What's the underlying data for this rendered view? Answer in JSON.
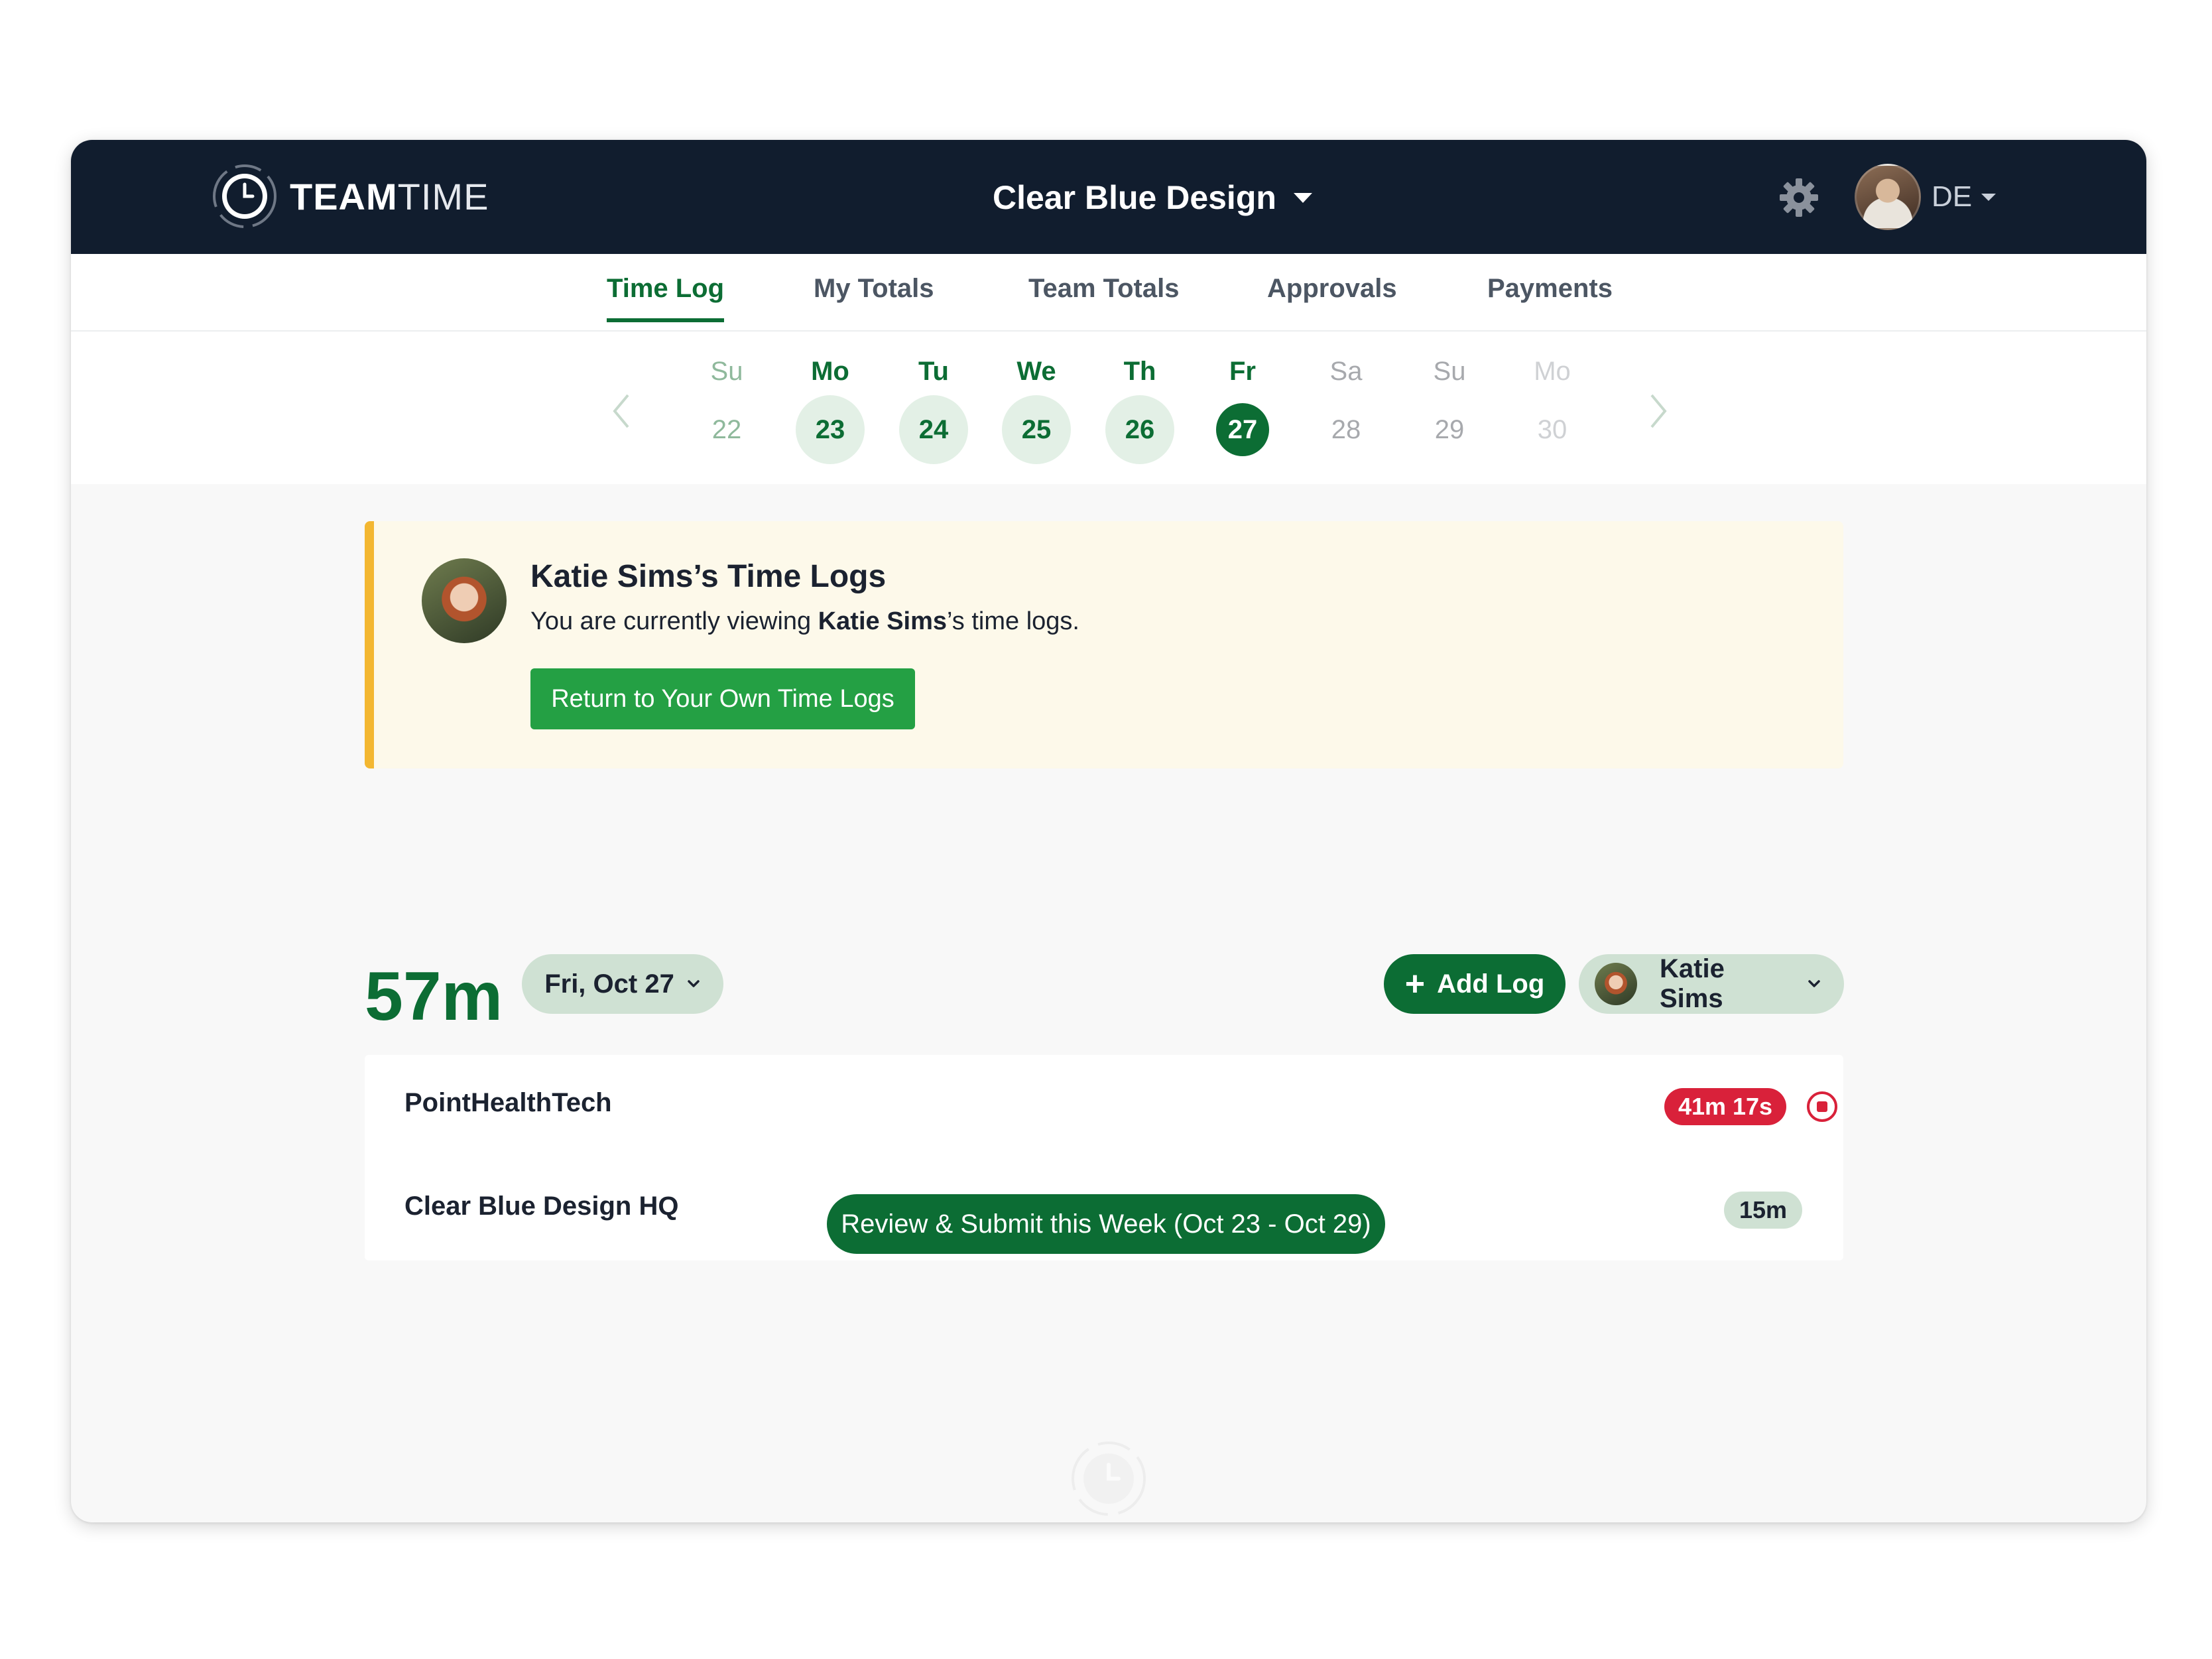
{
  "app": {
    "logo_bold": "TEAM",
    "logo_light": "TIME",
    "organization": "Clear Blue Design",
    "user_initials": "DE"
  },
  "tabs": [
    {
      "label": "Time Log",
      "active": true
    },
    {
      "label": "My Totals"
    },
    {
      "label": "Team Totals"
    },
    {
      "label": "Approvals"
    },
    {
      "label": "Payments"
    }
  ],
  "week": {
    "days": [
      {
        "name": "Su",
        "num": "22"
      },
      {
        "name": "Mo",
        "num": "23"
      },
      {
        "name": "Tu",
        "num": "24"
      },
      {
        "name": "We",
        "num": "25"
      },
      {
        "name": "Th",
        "num": "26"
      },
      {
        "name": "Fr",
        "num": "27"
      },
      {
        "name": "Sa",
        "num": "28"
      },
      {
        "name": "Su",
        "num": "29"
      },
      {
        "name": "Mo",
        "num": "30"
      }
    ],
    "selected": "27"
  },
  "banner": {
    "title": "Katie Sims’s Time Logs",
    "text_prefix": "You are currently viewing ",
    "text_name": "Katie Sims",
    "text_suffix": "’s time logs.",
    "button_label": "Return to Your Own Time Logs"
  },
  "summary": {
    "total": "57m",
    "date": "Fri, Oct 27",
    "add_log_label": "Add Log",
    "user_name": "Katie Sims"
  },
  "logs": [
    {
      "project": "PointHealthTech",
      "duration": "41m 17s",
      "running": true
    },
    {
      "project": "Clear Blue Design HQ",
      "duration": "15m",
      "running": false
    }
  ],
  "submit_label": "Review & Submit this Week (Oct 23 - Oct 29)",
  "colors": {
    "brand_green": "#0c6d34",
    "nav_dark": "#111d2e",
    "banner_accent": "#f3b731",
    "running_red": "#d9213a"
  },
  "icons": [
    "clock-logo-icon",
    "caret-down-icon",
    "gear-icon",
    "chevron-left-icon",
    "chevron-right-icon",
    "chevron-down-icon",
    "plus-icon",
    "stop-icon"
  ]
}
